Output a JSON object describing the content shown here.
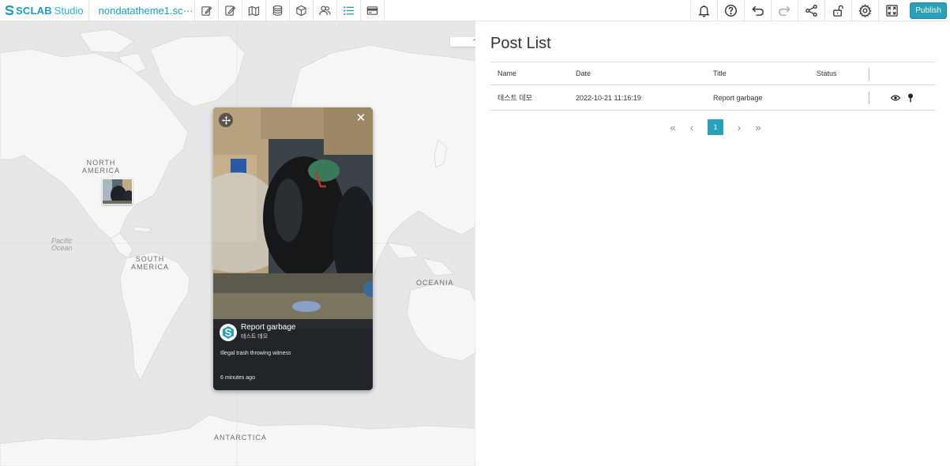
{
  "brand": {
    "name": "SCLAB",
    "suffix": "Studio"
  },
  "project": {
    "name": "nondatatheme1.sc···"
  },
  "toolbar": {
    "left_tools": [
      "edit-icon",
      "edit-alt-icon",
      "map-icon",
      "database-icon",
      "cube-icon",
      "users-icon",
      "list-icon",
      "card-icon"
    ],
    "right_tools": [
      "bell-icon",
      "help-icon",
      "undo-icon",
      "redo-icon",
      "share-icon",
      "unlock-icon",
      "gear-icon",
      "fullscreen-icon"
    ],
    "publish_label": "Publish"
  },
  "map": {
    "labels": {
      "north_america": "NORTH\nAMERICA",
      "south_america": "SOUTH\nAMERICA",
      "oceania": "OCEANIA",
      "antarctica": "ANTARCTICA",
      "pacific": "Pacific\nOcean"
    },
    "collapse_icon": "chevron-up-icon",
    "popup": {
      "title": "Report garbage",
      "author": "테스트 데모",
      "description": "Illegal trash throwing witness",
      "time": "6 minutes ago"
    }
  },
  "panel": {
    "title": "Post List",
    "columns": [
      "Name",
      "Date",
      "Title",
      "Status"
    ],
    "rows": [
      {
        "name": "테스트 데모",
        "date": "2022-10-21 11:16:19",
        "title": "Report garbage",
        "status": ""
      }
    ],
    "pagination": {
      "current": "1"
    }
  }
}
